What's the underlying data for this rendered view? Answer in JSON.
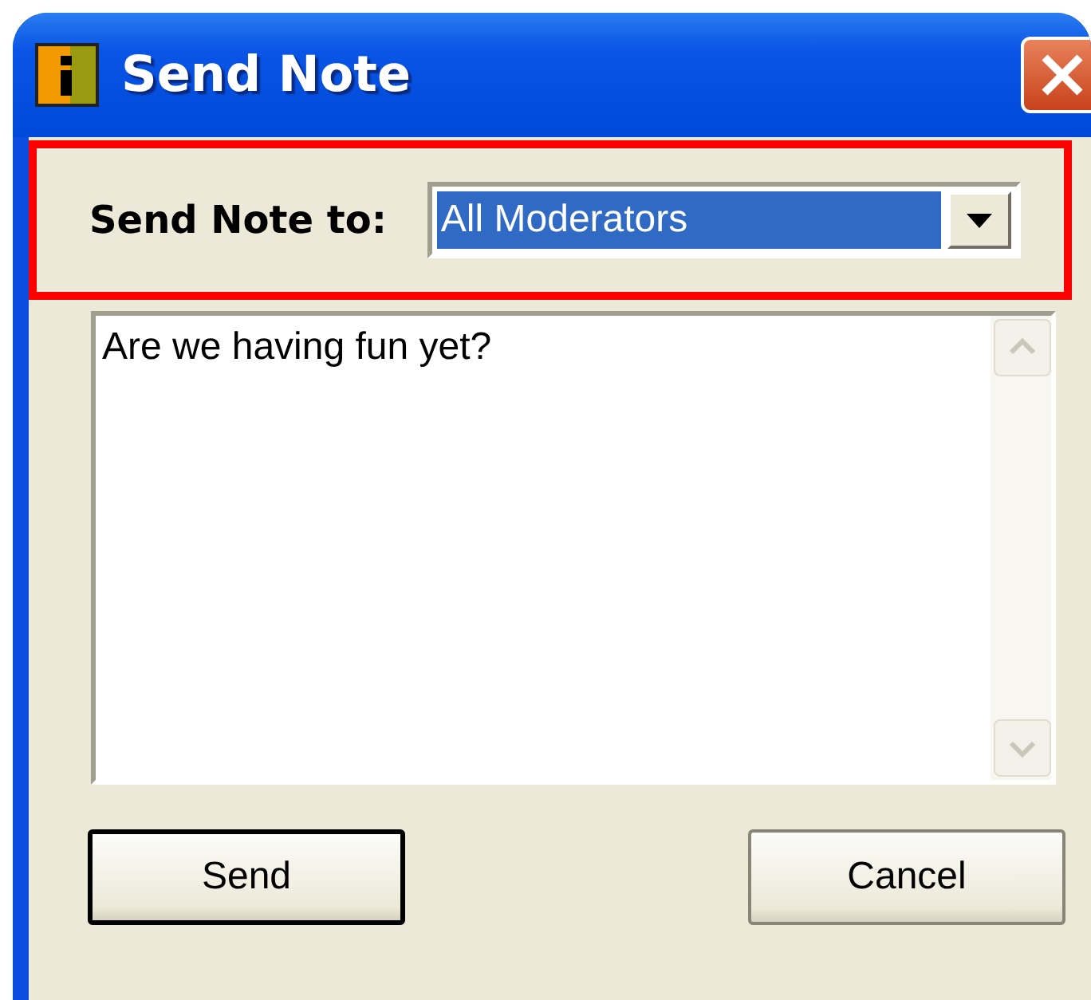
{
  "window": {
    "title": "Send Note"
  },
  "recipient": {
    "label": "Send Note to:",
    "value": "All Moderators"
  },
  "message": {
    "value": "Are we having fun yet?"
  },
  "buttons": [
    {
      "label": "Send",
      "default": true
    },
    {
      "label": "Cancel",
      "default": false
    }
  ]
}
